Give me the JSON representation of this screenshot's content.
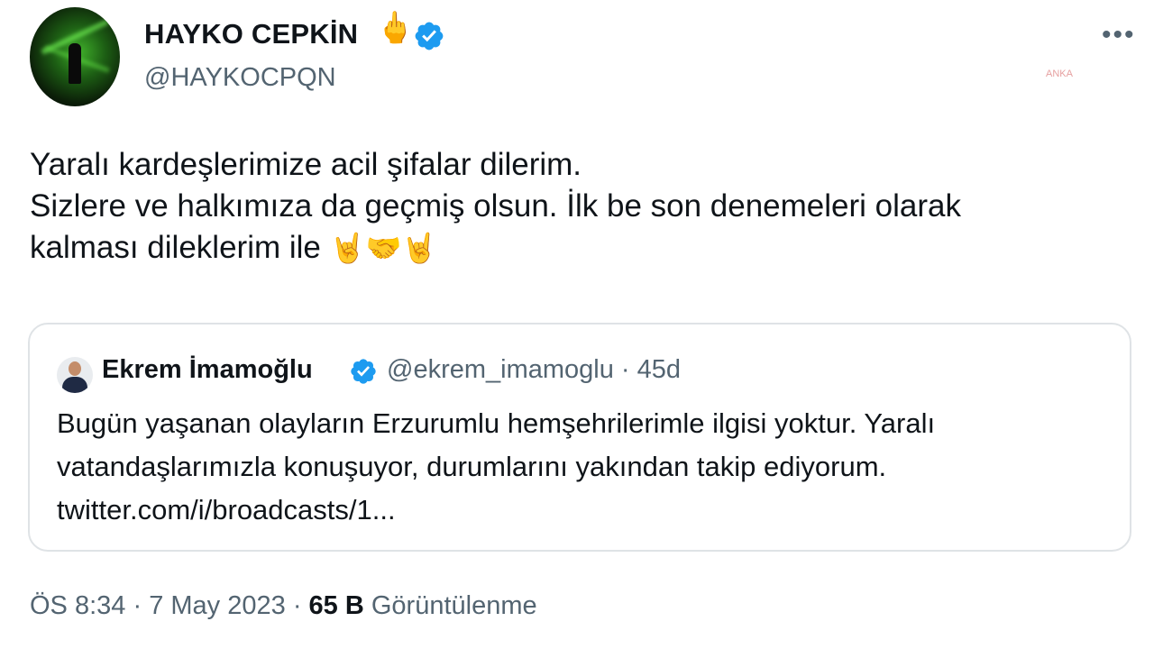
{
  "author": {
    "name": "HAYKO CEPKİN",
    "name_emoji": "🖕",
    "handle": "@HAYKOCPQN"
  },
  "menu_icon": "more-dots-icon",
  "verified_color": "#1d9bf0",
  "tweet": {
    "lines": [
      "Yaralı kardeşlerimize acil şifalar dilerim.",
      "Sizlere ve halkımıza da geçmiş olsun. İlk be son denemeleri olarak",
      "kalması dileklerim ile"
    ],
    "emojis": [
      "🤘",
      "🤝",
      "🤘"
    ]
  },
  "quoted": {
    "name": "Ekrem İmamoğlu",
    "handle": "@ekrem_imamoglu",
    "separator": "·",
    "age": "45d",
    "lines": [
      "Bugün yaşanan olayların Erzurumlu hemşehrilerimle ilgisi yoktur. Yaralı",
      "vatandaşlarımızla konuşuyor, durumlarını yakından takip ediyorum.",
      "twitter.com/i/broadcasts/1..."
    ]
  },
  "footer": {
    "time": "ÖS 8:34",
    "sep1": "·",
    "date": "7 May 2023",
    "sep2": "·",
    "views_count": "65 B",
    "views_label": "Görüntülenme"
  },
  "watermark": "ANKA"
}
